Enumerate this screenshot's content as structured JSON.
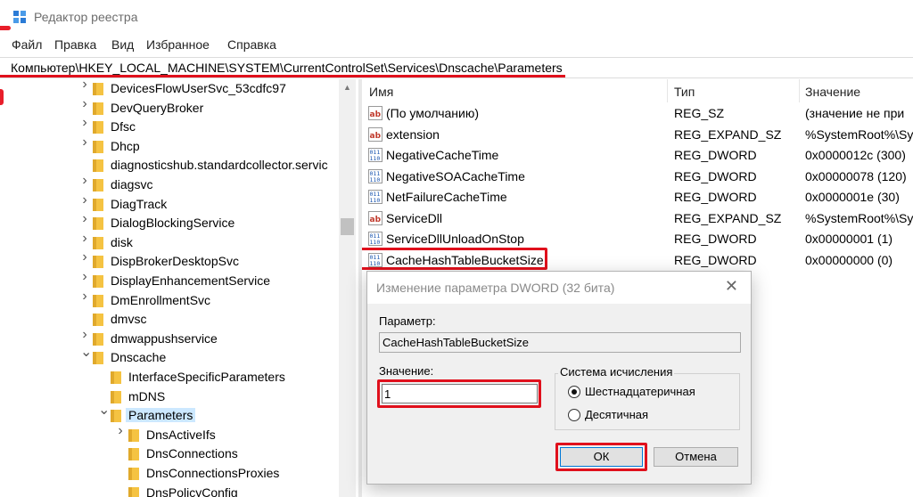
{
  "window": {
    "title": "Редактор реестра"
  },
  "menu": [
    "Файл",
    "Правка",
    "Вид",
    "Избранное",
    "Справка"
  ],
  "address": "Компьютер\\HKEY_LOCAL_MACHINE\\SYSTEM\\CurrentControlSet\\Services\\Dnscache\\Parameters",
  "tree": [
    {
      "label": "DevicesFlowUserSvc_53cdfc97",
      "level": 0,
      "chevron": "right"
    },
    {
      "label": "DevQueryBroker",
      "level": 0,
      "chevron": "right"
    },
    {
      "label": "Dfsc",
      "level": 0,
      "chevron": "right"
    },
    {
      "label": "Dhcp",
      "level": 0,
      "chevron": "right"
    },
    {
      "label": "diagnosticshub.standardcollector.servic",
      "level": 0,
      "chevron": "none"
    },
    {
      "label": "diagsvc",
      "level": 0,
      "chevron": "right"
    },
    {
      "label": "DiagTrack",
      "level": 0,
      "chevron": "right"
    },
    {
      "label": "DialogBlockingService",
      "level": 0,
      "chevron": "right"
    },
    {
      "label": "disk",
      "level": 0,
      "chevron": "right"
    },
    {
      "label": "DispBrokerDesktopSvc",
      "level": 0,
      "chevron": "right"
    },
    {
      "label": "DisplayEnhancementService",
      "level": 0,
      "chevron": "right"
    },
    {
      "label": "DmEnrollmentSvc",
      "level": 0,
      "chevron": "right"
    },
    {
      "label": "dmvsc",
      "level": 0,
      "chevron": "none"
    },
    {
      "label": "dmwappushservice",
      "level": 0,
      "chevron": "right"
    },
    {
      "label": "Dnscache",
      "level": 0,
      "chevron": "down"
    },
    {
      "label": "InterfaceSpecificParameters",
      "level": 1,
      "chevron": "none"
    },
    {
      "label": "mDNS",
      "level": 1,
      "chevron": "none"
    },
    {
      "label": "Parameters",
      "level": 1,
      "chevron": "down",
      "selected": true
    },
    {
      "label": "DnsActiveIfs",
      "level": 2,
      "chevron": "right"
    },
    {
      "label": "DnsConnections",
      "level": 2,
      "chevron": "none"
    },
    {
      "label": "DnsConnectionsProxies",
      "level": 2,
      "chevron": "none"
    },
    {
      "label": "DnsPolicyConfig",
      "level": 2,
      "chevron": "none"
    }
  ],
  "columns": {
    "name": "Имя",
    "type": "Тип",
    "value": "Значение"
  },
  "values": [
    {
      "icon": "string-value-icon",
      "name": "(По умолчанию)",
      "type": "REG_SZ",
      "data": "(значение не при"
    },
    {
      "icon": "string-value-icon",
      "name": "extension",
      "type": "REG_EXPAND_SZ",
      "data": "%SystemRoot%\\Sy"
    },
    {
      "icon": "binary-value-icon",
      "name": "NegativeCacheTime",
      "type": "REG_DWORD",
      "data": "0x0000012c (300)"
    },
    {
      "icon": "binary-value-icon",
      "name": "NegativeSOACacheTime",
      "type": "REG_DWORD",
      "data": "0x00000078 (120)"
    },
    {
      "icon": "binary-value-icon",
      "name": "NetFailureCacheTime",
      "type": "REG_DWORD",
      "data": "0x0000001e (30)"
    },
    {
      "icon": "string-value-icon",
      "name": "ServiceDll",
      "type": "REG_EXPAND_SZ",
      "data": "%SystemRoot%\\Sy"
    },
    {
      "icon": "binary-value-icon",
      "name": "ServiceDllUnloadOnStop",
      "type": "REG_DWORD",
      "data": "0x00000001 (1)"
    },
    {
      "icon": "binary-value-icon",
      "name": "CacheHashTableBucketSize",
      "type": "REG_DWORD",
      "data": "0x00000000 (0)"
    }
  ],
  "dialog": {
    "title": "Изменение параметра DWORD (32 бита)",
    "param_label": "Параметр:",
    "param_value": "CacheHashTableBucketSize",
    "value_label": "Значение:",
    "value": "1",
    "radix_label": "Система исчисления",
    "radix_hex": "Шестнадцатеричная",
    "radix_dec": "Десятичная",
    "ok": "ОК",
    "cancel": "Отмена"
  },
  "colors": {
    "highlight_red": "#e0101c",
    "selection": "#cce8ff",
    "folder": "#f5c342"
  }
}
